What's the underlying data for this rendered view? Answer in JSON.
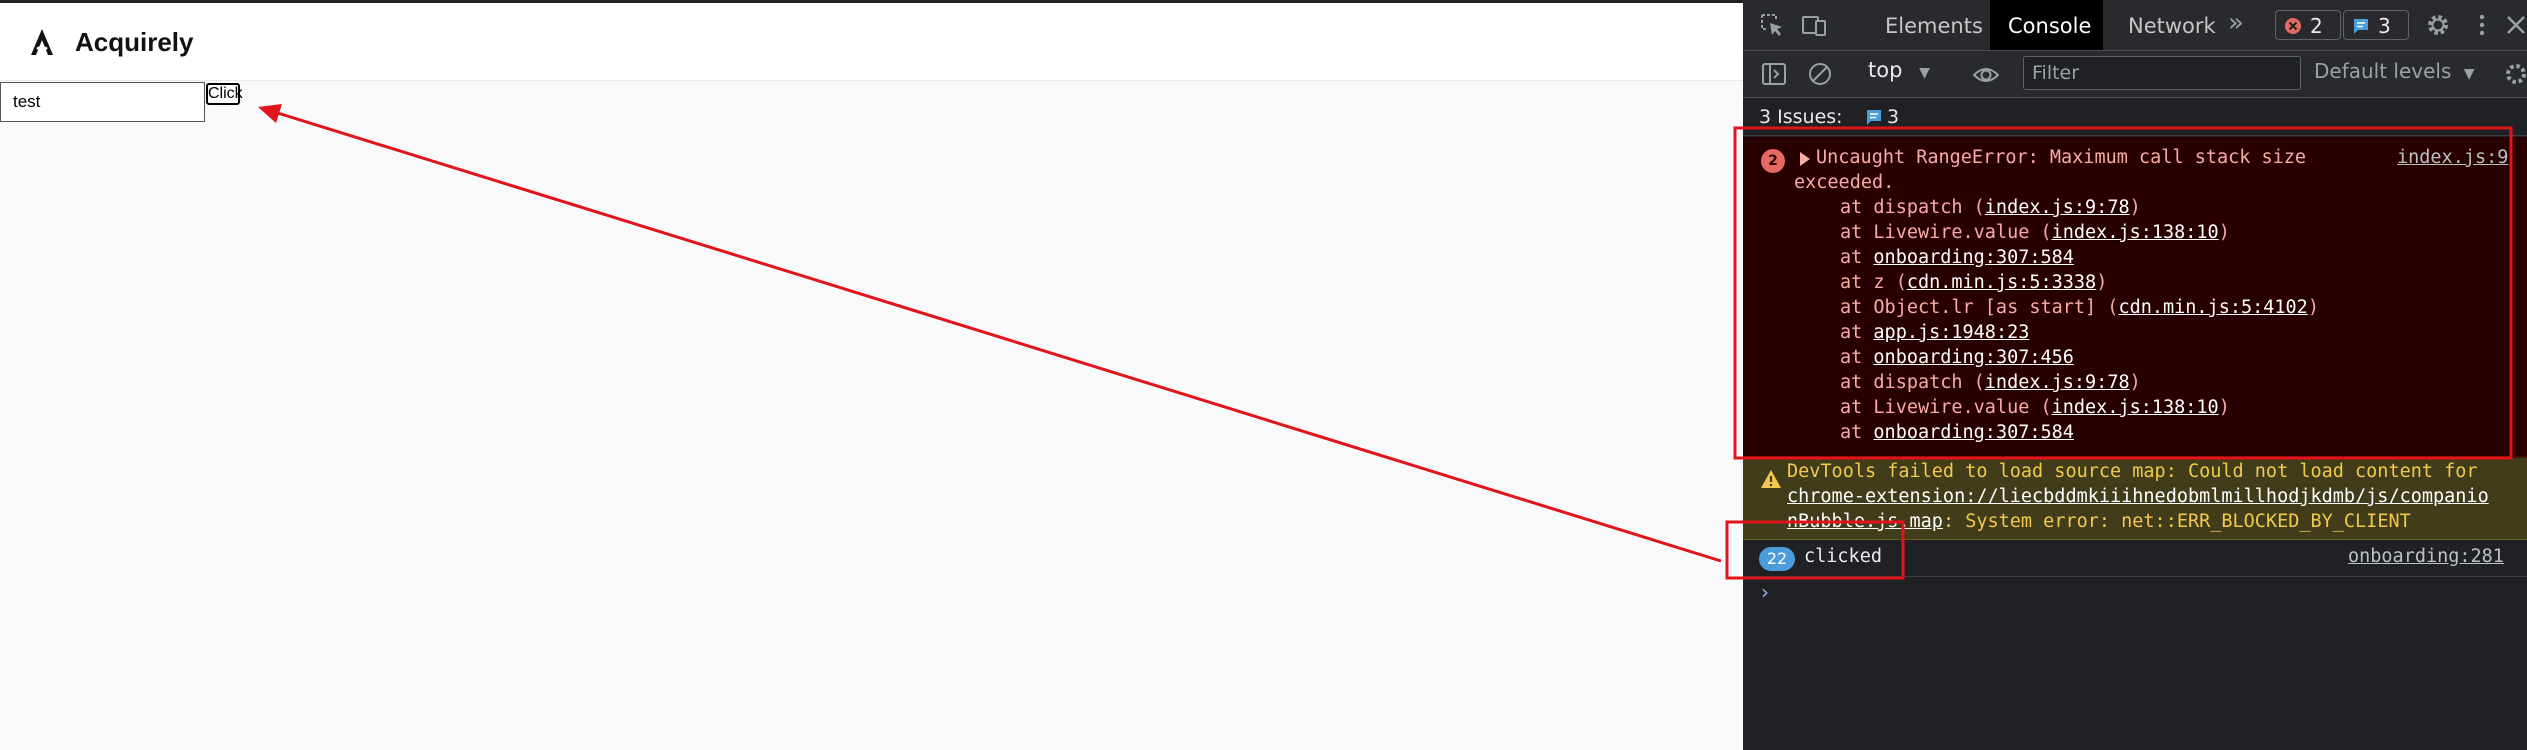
{
  "app": {
    "name": "Acquirely",
    "input_value": "test",
    "button_label": "Click"
  },
  "devtools": {
    "tabs": [
      {
        "label": "Elements",
        "active": false
      },
      {
        "label": "Console",
        "active": true
      },
      {
        "label": "Network",
        "active": false
      }
    ],
    "more_tabs_glyph": "»",
    "error_count": "2",
    "issue_count": "3",
    "context": "top",
    "filter_placeholder": "Filter",
    "levels_label": "Default levels",
    "issues_bar": {
      "label": "3 Issues:",
      "count": "3"
    },
    "error_message": {
      "count": "2",
      "line1": "Uncaught RangeError: Maximum call stack size",
      "line2": "exceeded.",
      "source": "index.js:9",
      "frames": [
        {
          "prefix": "at dispatch (",
          "link": "index.js:9:78",
          "suffix": ")"
        },
        {
          "prefix": "at Livewire.value (",
          "link": "index.js:138:10",
          "suffix": ")"
        },
        {
          "prefix": "at ",
          "link": "onboarding:307:584",
          "suffix": ""
        },
        {
          "prefix": "at z (",
          "link": "cdn.min.js:5:3338",
          "suffix": ")"
        },
        {
          "prefix": "at Object.lr [as start] (",
          "link": "cdn.min.js:5:4102",
          "suffix": ")"
        },
        {
          "prefix": "at ",
          "link": "app.js:1948:23",
          "suffix": ""
        },
        {
          "prefix": "at ",
          "link": "onboarding:307:456",
          "suffix": ""
        },
        {
          "prefix": "at dispatch (",
          "link": "index.js:9:78",
          "suffix": ")"
        },
        {
          "prefix": "at Livewire.value (",
          "link": "index.js:138:10",
          "suffix": ")"
        },
        {
          "prefix": "at ",
          "link": "onboarding:307:584",
          "suffix": ""
        }
      ]
    },
    "warning_message": {
      "line1": "DevTools failed to load source map: Could not load content for",
      "link_part1": "chrome-extension://liecbddmkiiihnedobmlmillhodjkdmb/js/compani",
      "link_part2": "o",
      "link_part3": "nBubble.js.map",
      "line3_suffix": ": System error: net::ERR_BLOCKED_BY_CLIENT"
    },
    "log_message": {
      "count": "22",
      "text": "clicked",
      "source": "onboarding:281"
    },
    "prompt_glyph": "›"
  },
  "colors": {
    "annotation": "#e0141a",
    "devtools_bg": "#202124",
    "error_bg": "#290000",
    "warning_bg": "#413c1a"
  }
}
